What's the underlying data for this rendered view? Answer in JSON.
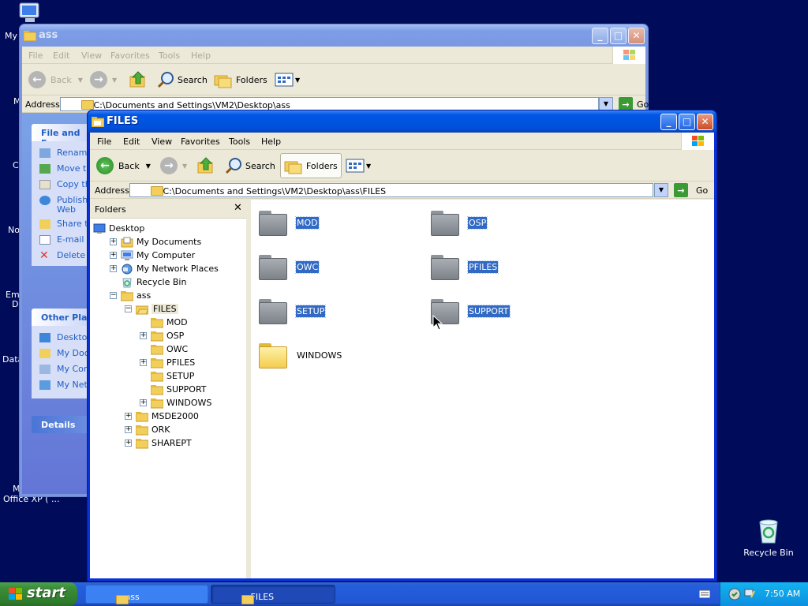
{
  "desktop": {
    "icons": [
      {
        "label": "My",
        "icon": "my-computer-icon"
      },
      {
        "label": "M",
        "icon": "generic"
      },
      {
        "label": "C",
        "icon": "generic"
      },
      {
        "label": "No",
        "icon": "generic"
      },
      {
        "label": "Em",
        "icon": "generic"
      },
      {
        "label": "D",
        "icon": "generic"
      },
      {
        "label": "Data",
        "icon": "generic"
      },
      {
        "label": "M",
        "icon": "generic"
      },
      {
        "label": "Office XP ( ...",
        "icon": "generic"
      }
    ],
    "recycle_bin_label": "Recycle Bin"
  },
  "back_window": {
    "title": "ass",
    "menu": [
      "File",
      "Edit",
      "View",
      "Favorites",
      "Tools",
      "Help"
    ],
    "toolbar": {
      "back": "Back",
      "search": "Search",
      "folders": "Folders"
    },
    "address_label": "Address",
    "address_value": "C:\\Documents and Settings\\VM2\\Desktop\\ass",
    "go_label": "Go",
    "task_sections": [
      {
        "title": "File and Fo",
        "links": [
          "Rename",
          "Move th",
          "Copy th",
          "Publish",
          "Web",
          "Share t",
          "E-mail t",
          "Delete"
        ]
      },
      {
        "title": "Other Plac",
        "links": [
          "Desktop",
          "My Doc",
          "My Com",
          "My Netv"
        ]
      },
      {
        "title": "Details",
        "links": []
      }
    ]
  },
  "front_window": {
    "title": "FILES",
    "menu": [
      "File",
      "Edit",
      "View",
      "Favorites",
      "Tools",
      "Help"
    ],
    "toolbar": {
      "back": "Back",
      "search": "Search",
      "folders": "Folders"
    },
    "address_label": "Address",
    "address_value": "C:\\Documents and Settings\\VM2\\Desktop\\ass\\FILES",
    "go_label": "Go",
    "folders_pane_title": "Folders",
    "tree": [
      {
        "label": "Desktop",
        "indent": 0,
        "expander": "",
        "icon": "desktop"
      },
      {
        "label": "My Documents",
        "indent": 1,
        "expander": "+",
        "icon": "docs"
      },
      {
        "label": "My Computer",
        "indent": 1,
        "expander": "+",
        "icon": "computer"
      },
      {
        "label": "My Network Places",
        "indent": 1,
        "expander": "+",
        "icon": "network"
      },
      {
        "label": "Recycle Bin",
        "indent": 1,
        "expander": "",
        "icon": "recycle"
      },
      {
        "label": "ass",
        "indent": 1,
        "expander": "-",
        "icon": "folder"
      },
      {
        "label": "FILES",
        "indent": 2,
        "expander": "-",
        "icon": "folder-open"
      },
      {
        "label": "MOD",
        "indent": 3,
        "expander": "",
        "icon": "folder"
      },
      {
        "label": "OSP",
        "indent": 3,
        "expander": "+",
        "icon": "folder"
      },
      {
        "label": "OWC",
        "indent": 3,
        "expander": "",
        "icon": "folder"
      },
      {
        "label": "PFILES",
        "indent": 3,
        "expander": "+",
        "icon": "folder"
      },
      {
        "label": "SETUP",
        "indent": 3,
        "expander": "",
        "icon": "folder"
      },
      {
        "label": "SUPPORT",
        "indent": 3,
        "expander": "",
        "icon": "folder"
      },
      {
        "label": "WINDOWS",
        "indent": 3,
        "expander": "+",
        "icon": "folder"
      },
      {
        "label": "MSDE2000",
        "indent": 2,
        "expander": "+",
        "icon": "folder"
      },
      {
        "label": "ORK",
        "indent": 2,
        "expander": "+",
        "icon": "folder"
      },
      {
        "label": "SHAREPT",
        "indent": 2,
        "expander": "+",
        "icon": "folder"
      }
    ],
    "items": [
      {
        "name": "MOD",
        "selected": true
      },
      {
        "name": "OSP",
        "selected": true
      },
      {
        "name": "OWC",
        "selected": true
      },
      {
        "name": "PFILES",
        "selected": true
      },
      {
        "name": "SETUP",
        "selected": true
      },
      {
        "name": "SUPPORT",
        "selected": true
      },
      {
        "name": "WINDOWS",
        "selected": false
      }
    ]
  },
  "taskbar": {
    "start_label": "start",
    "tasks": [
      {
        "label": "ass",
        "active": false
      },
      {
        "label": "FILES",
        "active": true
      }
    ],
    "clock": "7:50 AM"
  },
  "colors": {
    "desktop_bg": "#000c5a",
    "selection": "#316ac5",
    "title_active": "#0056e4"
  }
}
